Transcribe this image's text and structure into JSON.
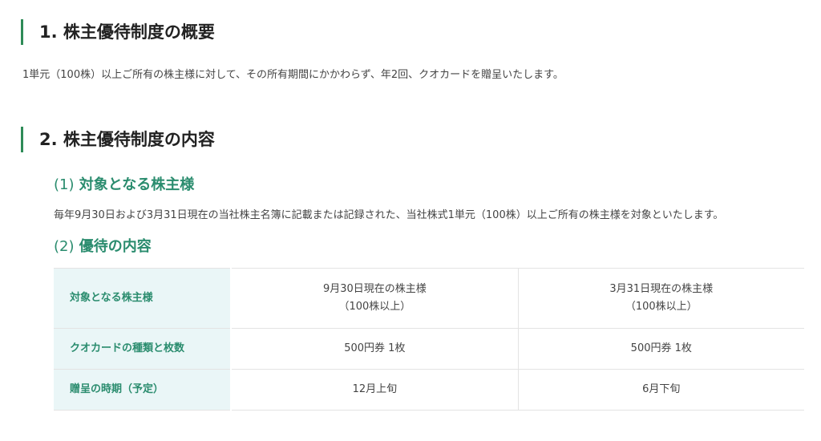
{
  "section1": {
    "heading": "1.  株主優待制度の概要",
    "text": "1単元（100株）以上ご所有の株主様に対して、その所有期間にかかわらず、年2回、クオカードを贈呈いたします。"
  },
  "section2": {
    "heading": "2.  株主優待制度の内容",
    "sub1": {
      "num": "(1)",
      "title": "対象となる株主様",
      "text": "毎年9月30日および3月31日現在の当社株主名簿に記載または記録された、当社株式1単元（100株）以上ご所有の株主様を対象といたします。"
    },
    "sub2": {
      "num": "(2)",
      "title": "優待の内容"
    },
    "table": {
      "rows": [
        {
          "header": "対象となる株主様",
          "col1": [
            "9月30日現在の株主様",
            "（100株以上）"
          ],
          "col2": [
            "3月31日現在の株主様",
            "（100株以上）"
          ]
        },
        {
          "header": "クオカードの種類と枚数",
          "col1": [
            "500円券 1枚"
          ],
          "col2": [
            "500円券 1枚"
          ]
        },
        {
          "header": "贈呈の時期（予定）",
          "col1": [
            "12月上旬"
          ],
          "col2": [
            "6月下旬"
          ]
        }
      ]
    }
  },
  "colors": {
    "accent_green": "#2e8b57",
    "subheading_teal": "#2a8c6e",
    "table_header_bg": "#eaf6f7"
  }
}
